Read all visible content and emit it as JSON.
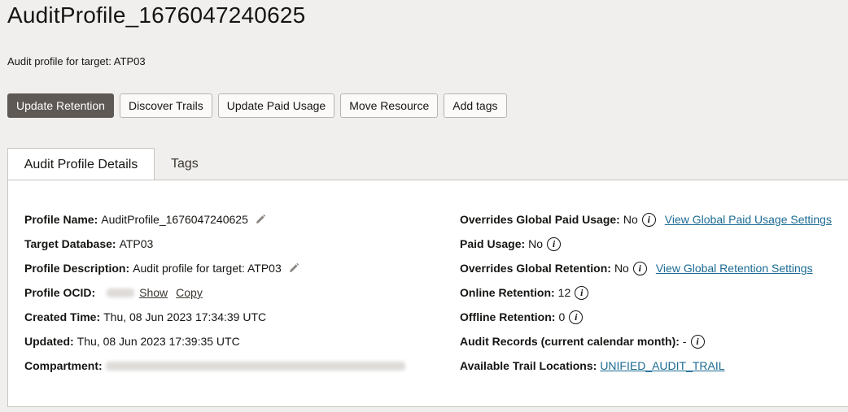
{
  "header": {
    "title": "AuditProfile_1676047240625",
    "subtitle": "Audit profile for target: ATP03"
  },
  "actions": [
    "Update Retention",
    "Discover Trails",
    "Update Paid Usage",
    "Move Resource",
    "Add tags"
  ],
  "tabs": [
    "Audit Profile Details",
    "Tags"
  ],
  "left": {
    "profile_name": {
      "label": "Profile Name:",
      "value": "AuditProfile_1676047240625"
    },
    "target_database": {
      "label": "Target Database:",
      "value": "ATP03"
    },
    "profile_description": {
      "label": "Profile Description:",
      "value": "Audit profile for target: ATP03"
    },
    "profile_ocid": {
      "label": "Profile OCID:",
      "show": "Show",
      "copy": "Copy"
    },
    "created_time": {
      "label": "Created Time:",
      "value": "Thu, 08 Jun 2023 17:34:39 UTC"
    },
    "updated": {
      "label": "Updated:",
      "value": "Thu, 08 Jun 2023 17:39:35 UTC"
    },
    "compartment": {
      "label": "Compartment:"
    }
  },
  "right": {
    "overrides_paid_usage": {
      "label": "Overrides Global Paid Usage:",
      "value": "No",
      "link": "View Global Paid Usage Settings"
    },
    "paid_usage": {
      "label": "Paid Usage:",
      "value": "No"
    },
    "overrides_retention": {
      "label": "Overrides Global Retention:",
      "value": "No",
      "link": "View Global Retention Settings"
    },
    "online_retention": {
      "label": "Online Retention:",
      "value": "12"
    },
    "offline_retention": {
      "label": "Offline Retention:",
      "value": "0"
    },
    "audit_records": {
      "label": "Audit Records (current calendar month):",
      "value": "-"
    },
    "trail_locations": {
      "label": "Available Trail Locations:",
      "link": "UNIFIED_AUDIT_TRAIL"
    }
  },
  "icons": {
    "edit": "pencil-icon",
    "info": "info-icon"
  },
  "colors": {
    "primary_button": "#5f5955",
    "link": "#1b6b93"
  }
}
